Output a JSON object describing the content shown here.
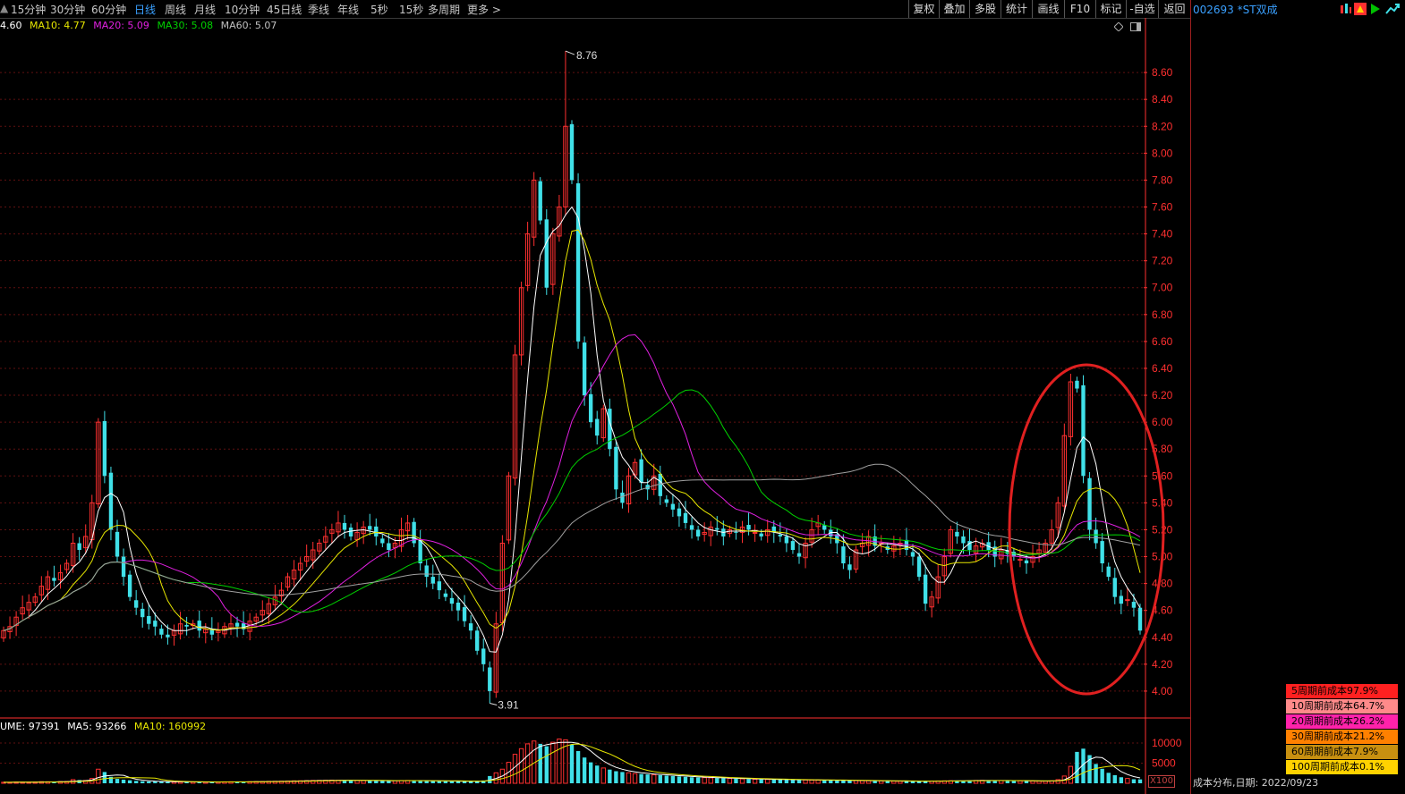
{
  "toolbar": {
    "periods": [
      "15分钟",
      "30分钟",
      "60分钟",
      "日线",
      "周线",
      "月线",
      "10分钟",
      "45日线",
      "季线",
      "年线",
      "5秒",
      "15秒",
      "多周期",
      "更多 >"
    ],
    "active_period": "日线",
    "tools": [
      "复权",
      "叠加",
      "多股",
      "统计",
      "画线",
      "F10",
      "标记",
      "-自选",
      "返回"
    ]
  },
  "stock": {
    "title": "002693 *ST双成"
  },
  "ma_line": {
    "current": "4.60",
    "ma10": "MA10: 4.77",
    "ma20": "MA20: 5.09",
    "ma30": "MA30: 5.08",
    "ma60": "MA60: 5.07"
  },
  "volume_line": {
    "volume": "UME: 97391",
    "ma5": "MA5: 93266",
    "ma10": "MA10: 160992"
  },
  "volume_unit": "X100",
  "cost_distribution": {
    "label": "成本分布,日期: 2022/09/23",
    "legend": [
      {
        "text": "5周期前成本97.9%",
        "color": "#ff2020"
      },
      {
        "text": "10周期前成本64.7%",
        "color": "#ff8a8a"
      },
      {
        "text": "20周期前成本26.2%",
        "color": "#ff22aa"
      },
      {
        "text": "30周期前成本21.2%",
        "color": "#ff8000"
      },
      {
        "text": "60周期前成本7.9%",
        "color": "#c89010"
      },
      {
        "text": "100周期前成本0.1%",
        "color": "#ffd200"
      }
    ]
  },
  "colors": {
    "up": "#ff3030",
    "down": "#40e0e8",
    "ma5": "#ffffff",
    "ma10": "#e6e600",
    "ma20": "#e020e0",
    "ma30": "#00d000",
    "ma60": "#a0a0a0",
    "axis": "#ff3030"
  },
  "chart_data": {
    "type": "candlestick",
    "price_axis": {
      "ticks": [
        "8.60",
        "8.40",
        "8.20",
        "8.00",
        "7.80",
        "7.60",
        "7.40",
        "7.20",
        "7.00",
        "6.80",
        "6.60",
        "6.40",
        "6.20",
        "6.00",
        "5.80",
        "5.60",
        "5.40",
        "5.20",
        "5.00",
        "4.80",
        "4.60",
        "4.40",
        "4.20",
        "4.00"
      ],
      "range": [
        3.82,
        8.86
      ]
    },
    "volume_axis": {
      "ticks": [
        "10000",
        "5000"
      ],
      "range": [
        0,
        12000
      ]
    },
    "annotations": {
      "high": "8.76",
      "low": "3.91"
    },
    "close": [
      4.45,
      4.48,
      4.55,
      4.62,
      4.66,
      4.7,
      4.78,
      4.85,
      4.82,
      4.88,
      4.95,
      5.1,
      5.05,
      5.15,
      5.4,
      6.0,
      5.6,
      5.2,
      5.0,
      4.85,
      4.7,
      4.62,
      4.55,
      4.5,
      4.48,
      4.42,
      4.4,
      4.45,
      4.5,
      4.48,
      4.5,
      4.45,
      4.46,
      4.42,
      4.45,
      4.48,
      4.5,
      4.48,
      4.46,
      4.52,
      4.55,
      4.6,
      4.65,
      4.7,
      4.75,
      4.85,
      4.9,
      4.95,
      5.0,
      5.05,
      5.1,
      5.15,
      5.2,
      5.25,
      5.2,
      5.15,
      5.18,
      5.22,
      5.2,
      5.15,
      5.1,
      5.05,
      5.1,
      5.2,
      5.25,
      5.1,
      4.95,
      4.85,
      4.8,
      4.75,
      4.7,
      4.65,
      4.6,
      4.52,
      4.45,
      4.3,
      4.2,
      4.0,
      4.5,
      5.1,
      5.6,
      6.5,
      7.0,
      7.4,
      7.8,
      7.5,
      7.0,
      7.4,
      7.6,
      8.2,
      7.8,
      6.6,
      6.2,
      6.0,
      5.9,
      6.1,
      5.8,
      5.5,
      5.4,
      5.6,
      5.7,
      5.55,
      5.5,
      5.6,
      5.45,
      5.4,
      5.35,
      5.3,
      5.25,
      5.2,
      5.15,
      5.18,
      5.22,
      5.2,
      5.15,
      5.2,
      5.18,
      5.22,
      5.2,
      5.18,
      5.15,
      5.2,
      5.18,
      5.15,
      5.1,
      5.05,
      5.0,
      5.1,
      5.2,
      5.25,
      5.2,
      5.15,
      5.1,
      4.95,
      4.9,
      5.05,
      5.1,
      5.15,
      5.08,
      5.1,
      5.05,
      5.08,
      5.1,
      5.05,
      5.0,
      4.85,
      4.65,
      4.7,
      4.85,
      5.0,
      5.2,
      5.15,
      5.1,
      5.05,
      5.08,
      5.1,
      5.05,
      5.0,
      5.05,
      5.02,
      5.0,
      4.98,
      4.95,
      5.0,
      5.05,
      5.1,
      5.2,
      5.4,
      5.9,
      6.3,
      6.25,
      5.6,
      5.2,
      5.1,
      4.95,
      4.85,
      4.7,
      4.65,
      4.68,
      4.62,
      4.45
    ],
    "volume": [
      250,
      220,
      300,
      280,
      260,
      320,
      400,
      380,
      360,
      420,
      450,
      900,
      800,
      700,
      1200,
      3500,
      2800,
      1600,
      1100,
      900,
      750,
      600,
      500,
      450,
      420,
      400,
      380,
      360,
      340,
      330,
      320,
      310,
      300,
      320,
      340,
      360,
      380,
      350,
      340,
      400,
      420,
      450,
      480,
      500,
      520,
      560,
      600,
      620,
      650,
      700,
      720,
      750,
      780,
      760,
      740,
      720,
      700,
      680,
      660,
      640,
      620,
      600,
      640,
      680,
      700,
      660,
      620,
      600,
      580,
      560,
      540,
      520,
      500,
      480,
      460,
      450,
      700,
      1800,
      2600,
      3500,
      5200,
      7200,
      8600,
      9800,
      10500,
      9800,
      9200,
      10200,
      11000,
      10800,
      9600,
      8000,
      6400,
      5200,
      4400,
      3800,
      3400,
      3000,
      2800,
      2600,
      2400,
      2300,
      2200,
      2100,
      2000,
      1900,
      1800,
      1700,
      1600,
      1500,
      1450,
      1400,
      1350,
      1300,
      1250,
      1200,
      1150,
      1100,
      1050,
      1000,
      980,
      950,
      930,
      900,
      880,
      860,
      840,
      820,
      800,
      780,
      760,
      740,
      720,
      700,
      680,
      660,
      640,
      620,
      600,
      580,
      560,
      540,
      520,
      500,
      500,
      520,
      540,
      560,
      580,
      600,
      620,
      640,
      660,
      680,
      700,
      720,
      700,
      680,
      660,
      640,
      620,
      600,
      580,
      560,
      540,
      520,
      600,
      900,
      1800,
      4200,
      7800,
      8600,
      7000,
      4800,
      3600,
      2600,
      2000,
      1500,
      1200,
      1000,
      974
    ]
  }
}
